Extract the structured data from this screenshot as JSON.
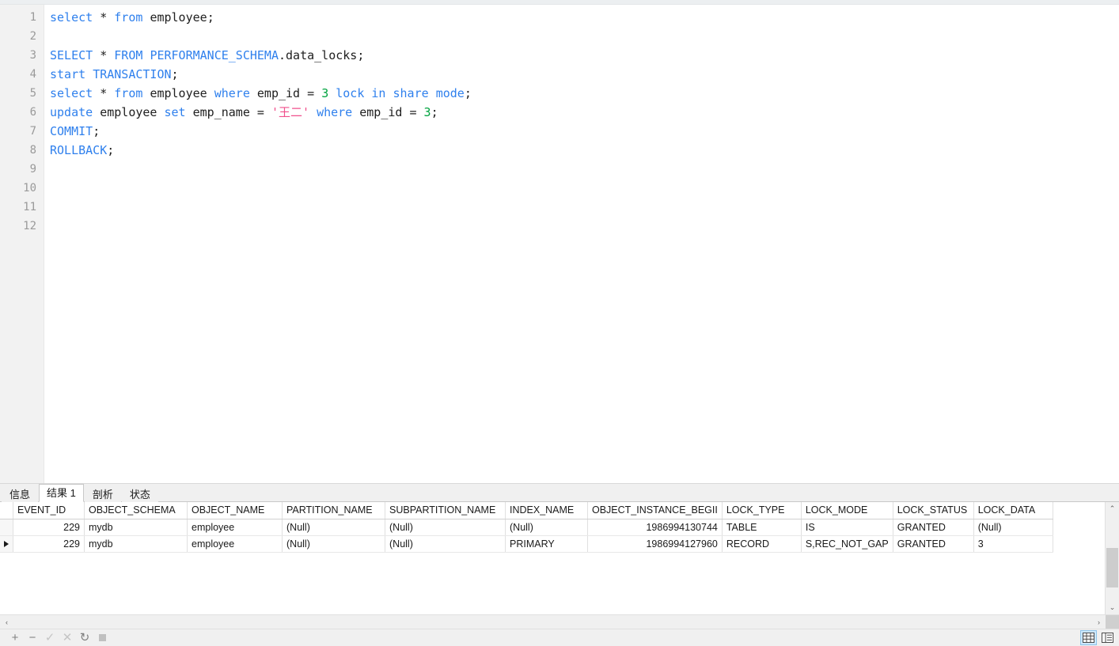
{
  "editor": {
    "line_numbers": [
      "1",
      "2",
      "3",
      "4",
      "5",
      "6",
      "7",
      "8",
      "9",
      "10",
      "11",
      "12"
    ],
    "lines": [
      {
        "n": 1,
        "text": "select * from employee;"
      },
      {
        "n": 2,
        "text": ""
      },
      {
        "n": 3,
        "text": "SELECT * FROM PERFORMANCE_SCHEMA.data_locks;"
      },
      {
        "n": 4,
        "text": "start TRANSACTION;"
      },
      {
        "n": 5,
        "text": "select * from employee where emp_id = 3 lock in share mode;"
      },
      {
        "n": 6,
        "text": "update employee set emp_name = '王二' where emp_id = 3;"
      },
      {
        "n": 7,
        "text": "COMMIT;"
      },
      {
        "n": 8,
        "text": "ROLLBACK;"
      },
      {
        "n": 9,
        "text": ""
      },
      {
        "n": 10,
        "text": ""
      },
      {
        "n": 11,
        "text": ""
      },
      {
        "n": 12,
        "text": ""
      }
    ],
    "colors": {
      "keyword": "#2f80ed",
      "number": "#00a33f",
      "string": "#f0508c",
      "identifier": "#202020",
      "gutter_text": "#9a9a9a",
      "gutter_bg": "#f2f2f2"
    }
  },
  "results": {
    "tabs": [
      {
        "label": "信息",
        "active": false
      },
      {
        "label": "结果 1",
        "active": true
      },
      {
        "label": "剖析",
        "active": false
      },
      {
        "label": "状态",
        "active": false
      }
    ],
    "columns": [
      "EVENT_ID",
      "OBJECT_SCHEMA",
      "OBJECT_NAME",
      "PARTITION_NAME",
      "SUBPARTITION_NAME",
      "INDEX_NAME",
      "OBJECT_INSTANCE_BEGII",
      "LOCK_TYPE",
      "LOCK_MODE",
      "LOCK_STATUS",
      "LOCK_DATA"
    ],
    "rows": [
      {
        "current": false,
        "cells": [
          "229",
          "mydb",
          "employee",
          "(Null)",
          "(Null)",
          "(Null)",
          "1986994130744",
          "TABLE",
          "IS",
          "GRANTED",
          "(Null)"
        ]
      },
      {
        "current": true,
        "cells": [
          "229",
          "mydb",
          "employee",
          "(Null)",
          "(Null)",
          "PRIMARY",
          "1986994127960",
          "RECORD",
          "S,REC_NOT_GAP",
          "GRANTED",
          "3"
        ]
      }
    ],
    "null_text": "(Null)"
  },
  "toolbar": {
    "add_label": "+",
    "remove_label": "−",
    "confirm_label": "✓",
    "cancel_label": "✕",
    "refresh_label": "↻",
    "stop_label": ""
  },
  "scroll": {
    "up_arrow": "⌃",
    "down_arrow": "⌄",
    "left_arrow": "‹",
    "right_arrow": "›"
  }
}
